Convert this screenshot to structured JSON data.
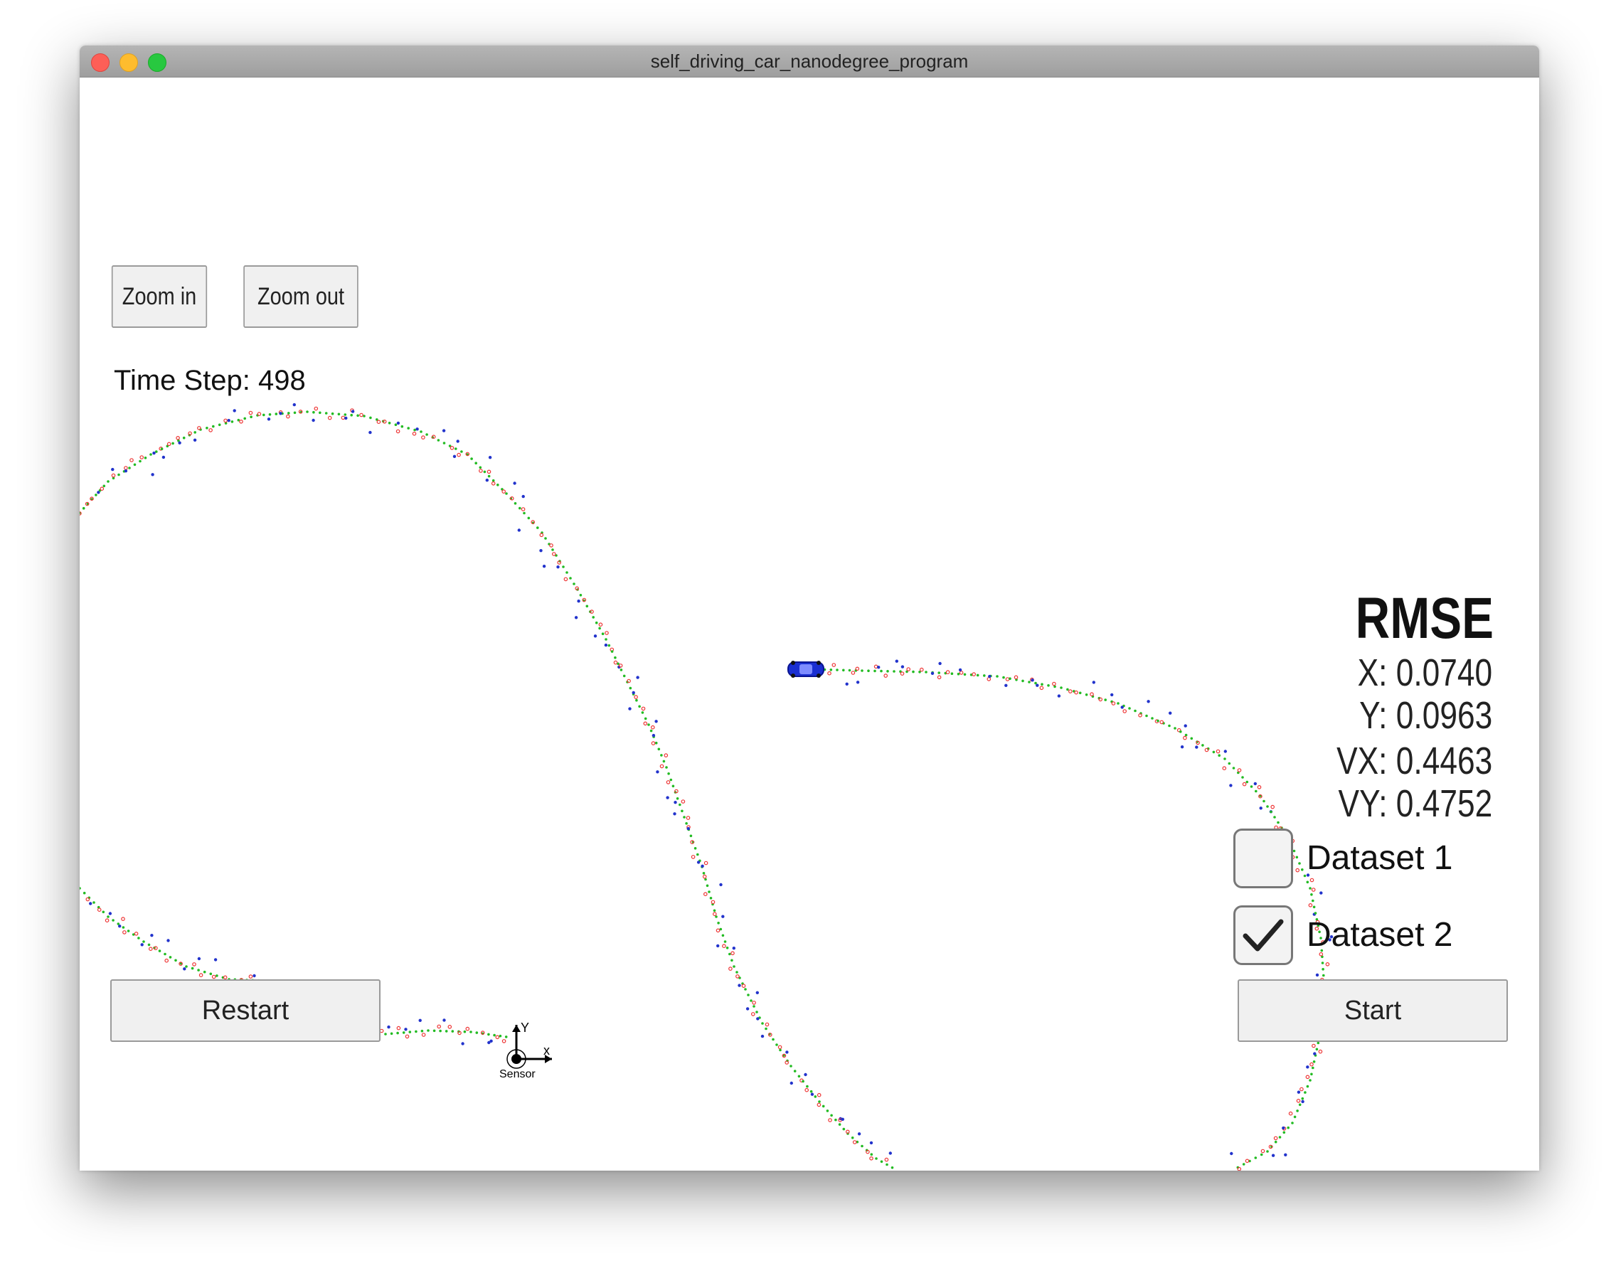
{
  "window": {
    "title": "self_driving_car_nanodegree_program"
  },
  "toolbar": {
    "zoom_in_label": "Zoom in",
    "zoom_out_label": "Zoom out"
  },
  "status": {
    "time_step_label": "Time Step: 498"
  },
  "rmse": {
    "title": "RMSE",
    "x": "X: 0.0740",
    "y": "Y: 0.0963",
    "vx": "VX: 0.4463",
    "vy": "VY: 0.4752"
  },
  "datasets": [
    {
      "label": "Dataset 1",
      "checked": false
    },
    {
      "label": "Dataset 2",
      "checked": true
    }
  ],
  "controls": {
    "restart_label": "Restart",
    "start_label": "Start"
  },
  "sensor": {
    "label": "Sensor",
    "x_axis_label": "x",
    "y_axis_label": "Y"
  },
  "colors": {
    "ground_truth": "#22bb22",
    "lidar": "#ee3333",
    "radar": "#2233cc",
    "car": "#1a2fd1"
  },
  "icons": {
    "car": "car-icon",
    "sensor": "sensor-axes-icon",
    "checkmark": "checkmark-icon"
  }
}
